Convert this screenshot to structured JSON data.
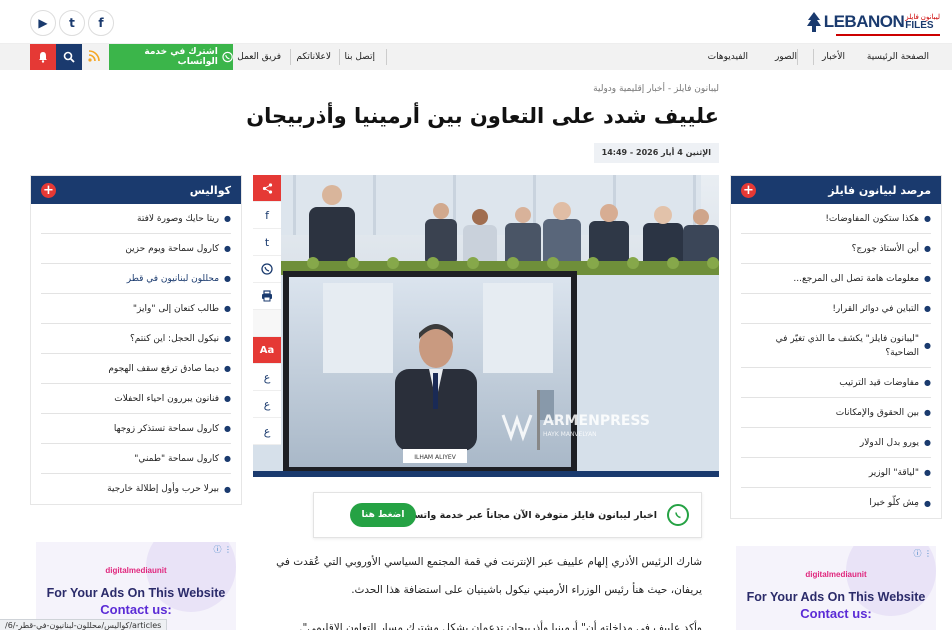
{
  "header": {
    "logo": {
      "word": "LEBANON",
      "sub_top": "ليبانون فايلز",
      "sub_bottom": "FILES"
    },
    "social": [
      {
        "name": "youtube-icon",
        "glyph": "▶"
      },
      {
        "name": "twitter-icon",
        "glyph": "t"
      },
      {
        "name": "facebook-icon",
        "glyph": "f"
      }
    ]
  },
  "nav": {
    "items": [
      "الصفحة الرئيسية",
      "الأخبار",
      "الصور",
      "الفيديوهات",
      "إتصل بنا",
      "لاعلاناتكم",
      "فريق العمل"
    ],
    "whatsapp_label": "اشترك في خدمة الواتساب"
  },
  "article": {
    "breadcrumb": "ليبانون فايلز - أخبار إقليمية ودولية",
    "title": "علييف شدد على التعاون بين أرمينيا وأذربيجان",
    "date": "الإثنين 4 أيار 2026 - 14:49",
    "paragraph1": "شارك الرئيس الأذري إلهام علييف عبر الإنترنت في قمة المجتمع السياسي الأوروبي التي عُقدت في يريفان، حيث هنأ رئيس الوزراء الأرميني نيكول باشينيان على استضافة هذا الحدث.",
    "paragraph2": "وأكد علييف في مداخلته أن\" أرمينيا وأذربيجان تدعمان بشكل مشترك مسار التعاون الإقليمي\".",
    "photo": {
      "watermark": "ARMENPRESS",
      "watermark_sub": "HAYK MANVELYAN",
      "nameplate": "ILHAM ALIYEV"
    }
  },
  "share": {
    "items": [
      {
        "name": "share-icon",
        "glyph": "<"
      },
      {
        "name": "facebook-share-icon",
        "glyph": "f"
      },
      {
        "name": "twitter-share-icon",
        "glyph": "t"
      },
      {
        "name": "whatsapp-share-icon",
        "glyph": "◯"
      },
      {
        "name": "print-icon",
        "glyph": "⎙"
      },
      {
        "name": "font-size-button",
        "glyph": "Aa"
      },
      {
        "name": "font-option-1",
        "glyph": "ع"
      },
      {
        "name": "font-option-2",
        "glyph": "ع"
      },
      {
        "name": "font-option-3",
        "glyph": "ع"
      }
    ]
  },
  "whatsapp_banner": {
    "text": "اخبار ليبانون فايلز متوفرة الآن مجاناً عبر خدمة واتساب...",
    "button": "اضغط هنا"
  },
  "sidebar_right": {
    "title": "مرصد لبيانون فايلز",
    "items": [
      "هكذا ستكون المفاوضات!",
      "أين الأستاذ جورج؟",
      "معلومات هامة تصل الى المرجع...",
      "التباين في دوائر القرار!",
      "\"ليبانون فايلز\" يكشف ما الذي تغيّر في الضاحية؟",
      "مفاوضات قيد الترتيب",
      "بين الحقوق والإمكانات",
      "يورو بدل الدولار",
      "\"لياقة\" الوزير",
      "مِش كلّو خيرا"
    ]
  },
  "sidebar_left": {
    "title": "كواليس",
    "items": [
      "ريتا حايك وصورة لافتة",
      "كارول سماحة ويوم حزين",
      "محللون لبنانيون في قطر",
      "طالب كنعان إلى \"وايز\"",
      "نيكول الحجل: اين كنتم؟",
      "ديما صادق ترفع سقف الهجوم",
      "فنانون يبررون احياء الحفلات",
      "كارول سماحة تستذكر زوجها",
      "كارول سماحة \"طمني\"",
      "بيرلا حرب وأول إطلالة خارجية"
    ]
  },
  "ads": {
    "brand": "digitalmediaunit",
    "line1": "For Your Ads On This Website",
    "line2": "Contact us:"
  },
  "statusbar": {
    "url": "/كواليس/محللون-لبنانيون-في-قطر-/6/articles"
  }
}
